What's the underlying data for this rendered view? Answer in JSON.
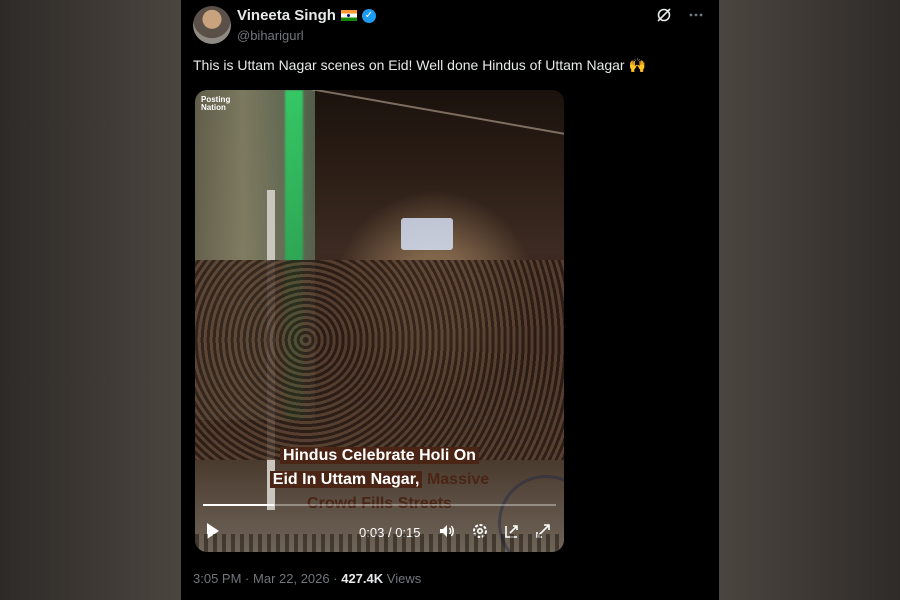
{
  "tweet": {
    "display_name": "Vineeta Singh",
    "handle": "@biharigurl",
    "text": "This is Uttam Nagar scenes on Eid! Well done Hindus of Uttam Nagar 🙌",
    "icons": [
      "flag-india-icon",
      "verified-badge-icon",
      "grok-icon",
      "more-icon"
    ]
  },
  "media": {
    "watermark": "Posting Nation",
    "caption_line1": "Hindus Celebrate Holi On",
    "caption_line2_highlight": "Eid In Uttam Nagar,",
    "caption_line2_plain": "Massive",
    "caption_line3": "Crowd Fills Streets",
    "player": {
      "current_time": "0:03",
      "separator": "/",
      "duration": "0:15",
      "progress_fraction": 0.2,
      "icons": [
        "play-icon",
        "volume-icon",
        "settings-icon",
        "pip-icon",
        "fullscreen-icon"
      ]
    }
  },
  "footer": {
    "time": "3:05 PM",
    "dot1": "·",
    "date": "Mar 22, 2026",
    "dot2": "·",
    "views_count": "427.4K",
    "views_label": "Views"
  },
  "colors": {
    "page_bg": "#000000",
    "text_primary": "#e7e9ea",
    "text_secondary": "#71767b",
    "verified_blue": "#1d9bf0",
    "caption_brown": "#4a2515"
  }
}
